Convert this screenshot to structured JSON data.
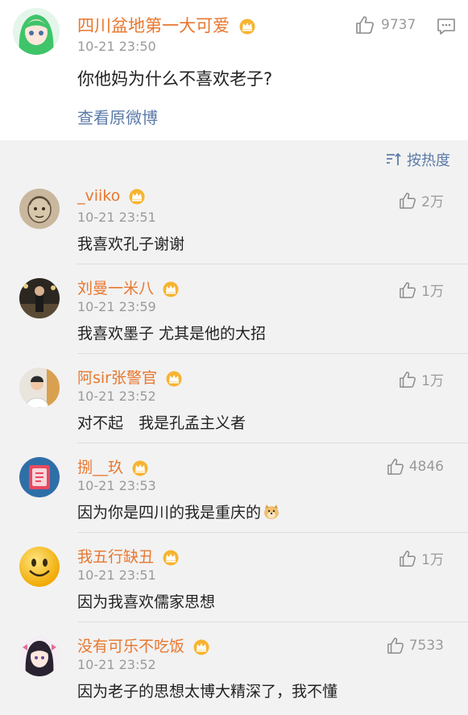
{
  "main_comment": {
    "author": "四川盆地第一大可爱",
    "time": "10-21 23:50",
    "text": "你他妈为什么不喜欢老子?",
    "view_original": "查看原微博",
    "likes": "9737"
  },
  "sort": {
    "label": "按热度"
  },
  "replies": [
    {
      "author": "_viiko",
      "time": "10-21 23:51",
      "text": "我喜欢孔子谢谢",
      "likes": "2万"
    },
    {
      "author": "刘曼一米八",
      "time": "10-21 23:59",
      "text": "我喜欢墨子 尤其是他的大招",
      "likes": "1万"
    },
    {
      "author": "阿sir张警官",
      "time": "10-21 23:52",
      "text": "对不起　我是孔孟主义者",
      "likes": "1万"
    },
    {
      "author": "捌__玖",
      "time": "10-21 23:53",
      "text": "因为你是四川的我是重庆的",
      "likes": "4846"
    },
    {
      "author": "我五行缺丑",
      "time": "10-21 23:51",
      "text": "因为我喜欢儒家思想",
      "likes": "1万"
    },
    {
      "author": "没有可乐不吃饭",
      "time": "10-21 23:52",
      "text": "因为老子的思想太博大精深了，我不懂",
      "likes": "7533"
    }
  ],
  "colors": {
    "name": "#e8772f",
    "link": "#5b7ba8",
    "meta": "#9a9a9a",
    "crown": "#f5a623"
  },
  "icons": [
    "thumbs-up-icon",
    "message-icon",
    "sort-icon",
    "crown-icon",
    "doge-emoji"
  ]
}
